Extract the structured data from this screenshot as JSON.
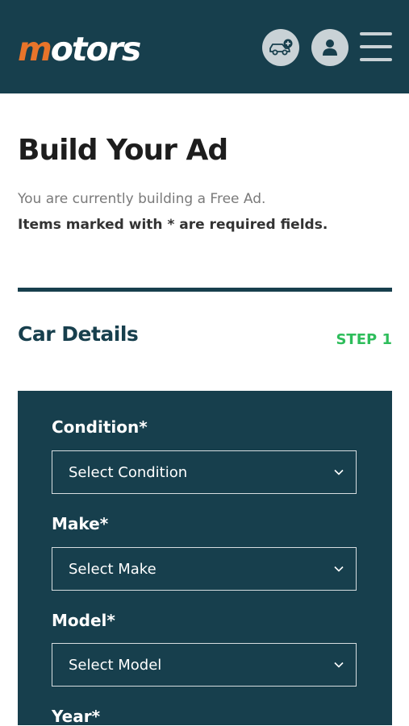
{
  "header": {
    "logo_accent": "m",
    "logo_rest": "otors",
    "icons": [
      "car-plus-icon",
      "user-icon",
      "hamburger-menu-icon"
    ],
    "colors": {
      "bar": "#173f4d",
      "logo_accent": "#e8742a"
    }
  },
  "page": {
    "title": "Build Your Ad",
    "subtitle": "You are currently building a Free Ad.",
    "required_note": "Items marked with * are required fields."
  },
  "section": {
    "title": "Car Details",
    "step": "STEP 1",
    "step_color": "#2ebd5b"
  },
  "form": {
    "condition": {
      "label": "Condition*",
      "value": "Select Condition"
    },
    "make": {
      "label": "Make*",
      "value": "Select Make"
    },
    "model": {
      "label": "Model*",
      "value": "Select Model"
    },
    "year": {
      "label": "Year*"
    }
  }
}
